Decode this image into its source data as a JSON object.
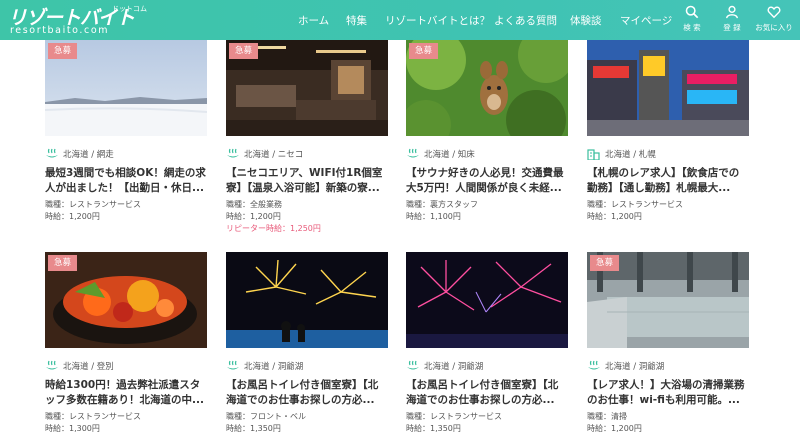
{
  "header": {
    "logo_main": "リゾートバイト",
    "logo_ruby": "ドットコム",
    "logo_sub": "resortbaito.com",
    "nav": [
      "ホーム",
      "特集",
      "リゾートバイトとは？",
      "よくある質問",
      "体験談",
      "マイページ"
    ],
    "utils": [
      {
        "label": "検 索",
        "icon": "search-icon"
      },
      {
        "label": "登 録",
        "icon": "user-icon"
      },
      {
        "label": "お気に入り",
        "icon": "heart-icon"
      }
    ]
  },
  "colors": {
    "header": "#3ec5a8",
    "badge": "#e88a8c",
    "repeat": "#e85a7a",
    "icon_green": "#3bbf9e"
  },
  "cards": [
    {
      "badge": "急募",
      "location": "北海道 / 網走",
      "loc_icon": "onsen-icon",
      "title": "最短3週間でも相談OK！網走の求人が出ました！【出勤日・休日...",
      "job": "職種：レストランサービス",
      "wage": "時給：1,200円",
      "repeat": ""
    },
    {
      "badge": "急募",
      "location": "北海道 / ニセコ",
      "loc_icon": "onsen-icon",
      "title": "【ニセコエリア、WIFI付1R個室寮】【温泉入浴可能】新築の寮...",
      "job": "職種：全般業務",
      "wage": "時給：1,200円",
      "repeat": "リピーター時給：1,250円"
    },
    {
      "badge": "急募",
      "location": "北海道 / 知床",
      "loc_icon": "onsen-icon",
      "title": "【サウナ好きの人必見！交通費最大5万円！人間関係が良く未経...",
      "job": "職種：裏方スタッフ",
      "wage": "時給：1,100円",
      "repeat": ""
    },
    {
      "badge": "",
      "location": "北海道 / 札幌",
      "loc_icon": "building-icon",
      "title": "【札幌のレア求人】【飲食店での勤務】【通し勤務】札幌最大...",
      "job": "職種：レストランサービス",
      "wage": "時給：1,200円",
      "repeat": ""
    },
    {
      "badge": "急募",
      "location": "北海道 / 登別",
      "loc_icon": "onsen-icon",
      "title": "時給1300円！過去弊社派遣スタッフ多数在籍あり！北海道の中...",
      "job": "職種：レストランサービス",
      "wage": "時給：1,300円",
      "repeat": ""
    },
    {
      "badge": "",
      "location": "北海道 / 洞爺湖",
      "loc_icon": "onsen-icon",
      "title": "【お風呂トイレ付き個室寮】【北海道でのお仕事お探しの方必...",
      "job": "職種：フロント・ベル",
      "wage": "時給：1,350円",
      "repeat": ""
    },
    {
      "badge": "",
      "location": "北海道 / 洞爺湖",
      "loc_icon": "onsen-icon",
      "title": "【お風呂トイレ付き個室寮】【北海道でのお仕事お探しの方必...",
      "job": "職種：レストランサービス",
      "wage": "時給：1,350円",
      "repeat": ""
    },
    {
      "badge": "急募",
      "location": "北海道 / 洞爺湖",
      "loc_icon": "onsen-icon",
      "title": "【レア求人！】大浴場の清掃業務のお仕事！wi-fiも利用可能。...",
      "job": "職種：清掃",
      "wage": "時給：1,200円",
      "repeat": ""
    }
  ]
}
